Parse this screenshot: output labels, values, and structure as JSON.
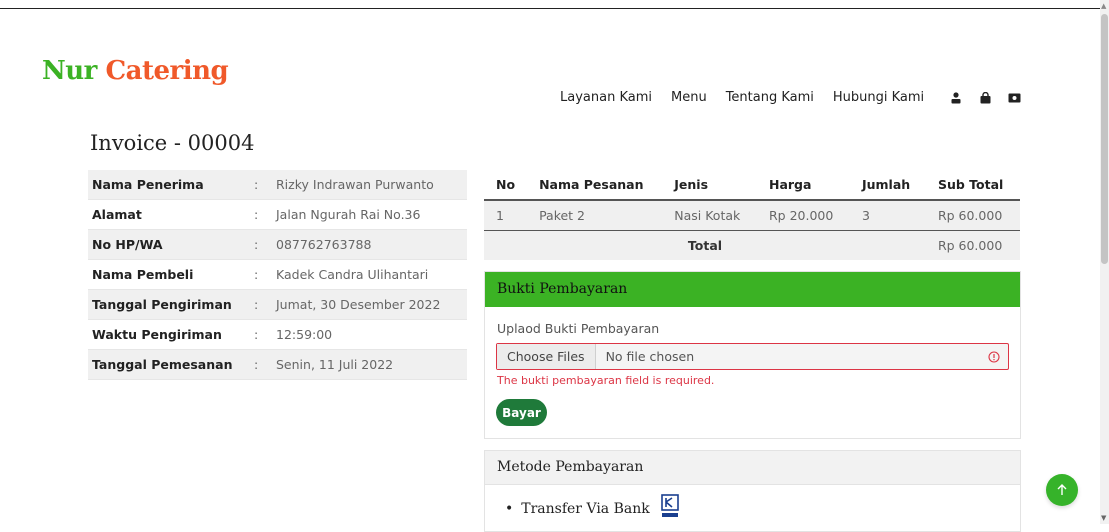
{
  "brand": {
    "part1": "Nur",
    "part2": "Catering"
  },
  "nav": {
    "items": [
      "Layanan Kami",
      "Menu",
      "Tentang Kami",
      "Hubungi Kami"
    ],
    "icons": [
      "user-icon",
      "bag-icon",
      "card-icon"
    ]
  },
  "invoice": {
    "title": "Invoice - 00004"
  },
  "info": [
    {
      "label": "Nama Penerima",
      "sep": ":",
      "value": "Rizky Indrawan Purwanto"
    },
    {
      "label": "Alamat",
      "sep": ":",
      "value": "Jalan Ngurah Rai No.36"
    },
    {
      "label": "No HP/WA",
      "sep": ":",
      "value": "087762763788"
    },
    {
      "label": "Nama Pembeli",
      "sep": ":",
      "value": "Kadek Candra Ulihantari"
    },
    {
      "label": "Tanggal Pengiriman",
      "sep": ":",
      "value": "Jumat, 30 Desember 2022"
    },
    {
      "label": "Waktu Pengiriman",
      "sep": ":",
      "value": "12:59:00"
    },
    {
      "label": "Tanggal Pemesanan",
      "sep": ":",
      "value": "Senin, 11 Juli 2022"
    }
  ],
  "order": {
    "headers": [
      "No",
      "Nama Pesanan",
      "Jenis",
      "Harga",
      "Jumlah",
      "Sub Total"
    ],
    "rows": [
      {
        "no": "1",
        "nama": "Paket 2",
        "jenis": "Nasi Kotak",
        "harga": "Rp 20.000",
        "jumlah": "3",
        "subtotal": "Rp 60.000"
      }
    ],
    "total_label": "Total",
    "total_value": "Rp 60.000"
  },
  "payment": {
    "title": "Bukti Pembayaran",
    "upload_label": "Uplaod Bukti Pembayaran",
    "choose_label": "Choose Files",
    "no_file": "No file chosen",
    "error": "The bukti pembayaran field is required.",
    "submit_label": "Bayar"
  },
  "method": {
    "title": "Metode Pembayaran",
    "items": [
      {
        "label": "Transfer Via Bank",
        "logo": "bank-bri-logo"
      }
    ]
  },
  "colors": {
    "green": "#3bb224",
    "orange": "#f0592a",
    "error": "#dc3545",
    "button": "#1f7a3a"
  }
}
